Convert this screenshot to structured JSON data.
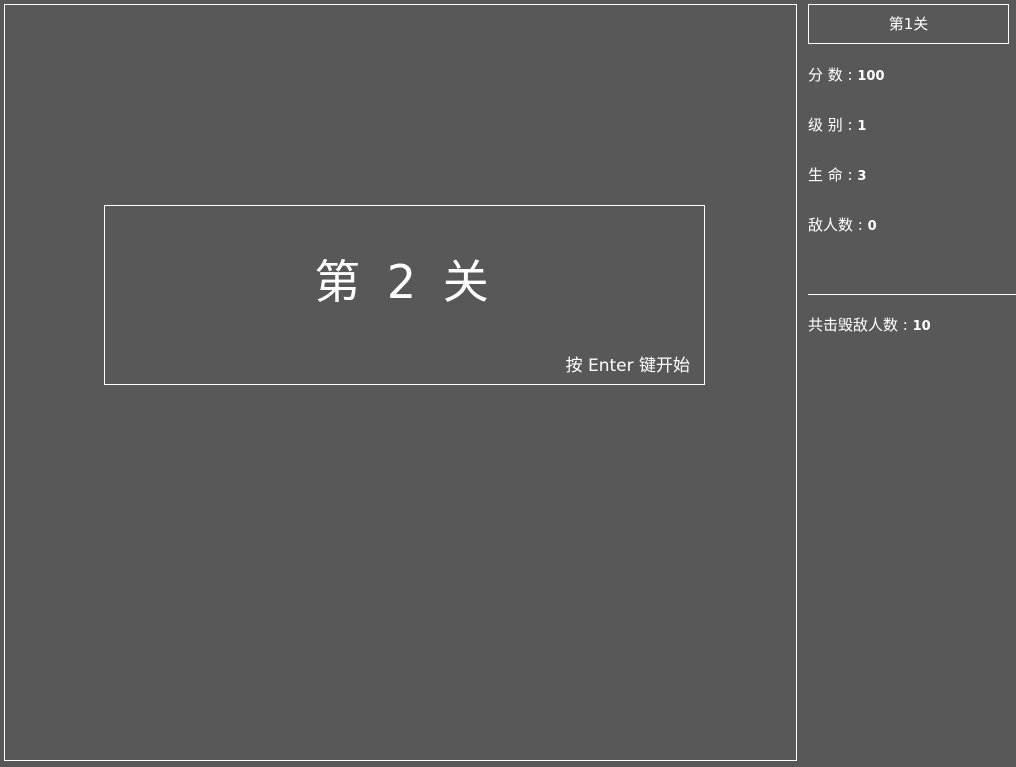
{
  "stage": {
    "modal": {
      "title": "第 2 关",
      "hint": "按 Enter 键开始"
    }
  },
  "sidebar": {
    "level_banner": "第1关",
    "score_label": "分 数 : ",
    "score_value": "100",
    "rank_label": "级 别 : ",
    "rank_value": "1",
    "lives_label": "生 命 : ",
    "lives_value": "3",
    "enemies_label": "敌人数 : ",
    "enemies_value": "0",
    "destroyed_label": "共击毁敌人数 : ",
    "destroyed_value": "10"
  },
  "colors": {
    "background": "#585858",
    "foreground": "#ffffff"
  }
}
